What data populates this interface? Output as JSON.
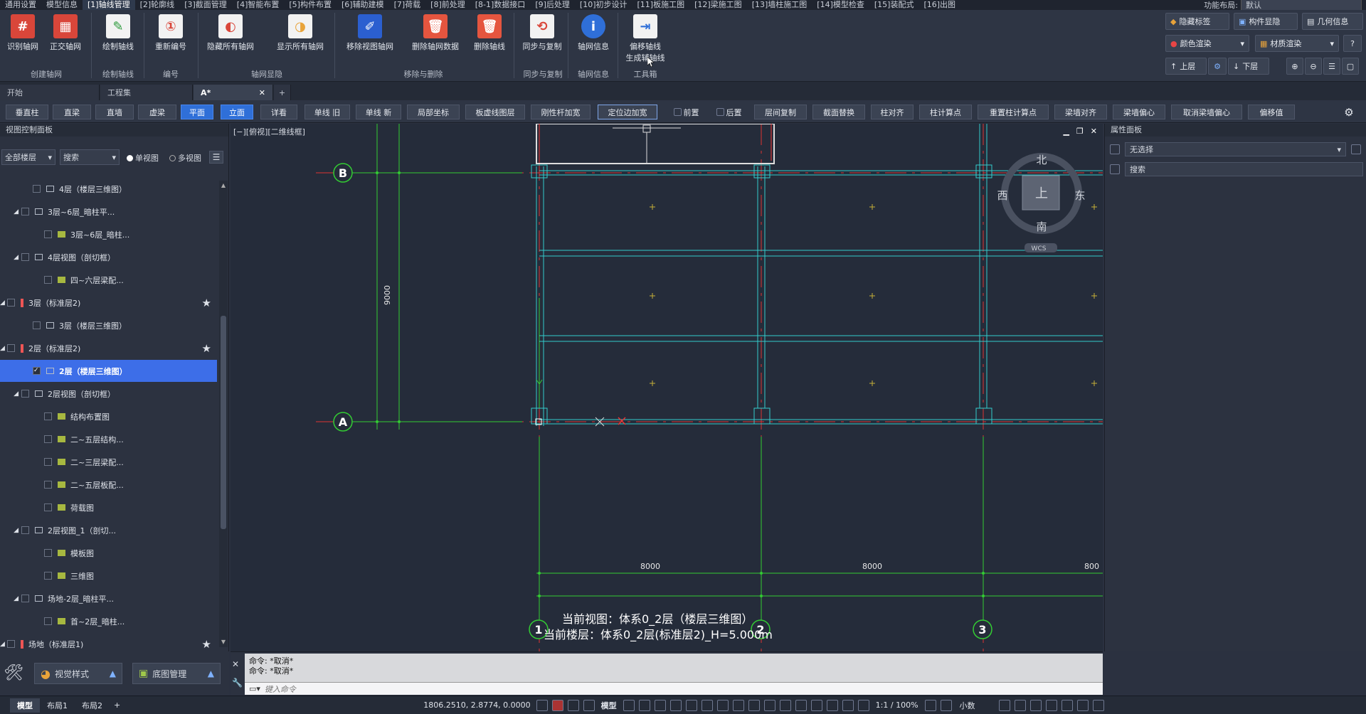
{
  "menu": {
    "items": [
      "通用设置",
      "模型信息",
      "[1]轴线管理",
      "[2]轮廓线",
      "[3]截面管理",
      "[4]智能布置",
      "[5]构件布置",
      "[6]辅助建模",
      "[7]荷载",
      "[8]前处理",
      "[8-1]数据接口",
      "[9]后处理",
      "[10]初步设计",
      "[11]板施工图",
      "[12]梁施工图",
      "[13]墙柱施工图",
      "[14]模型检查",
      "[15]装配式",
      "[16]出图"
    ],
    "layout_label": "功能布局:",
    "layout_value": "默认"
  },
  "ribbon": {
    "buttons": [
      "识别轴网",
      "正交轴网",
      "绘制轴线",
      "重新编号",
      "隐藏所有轴网",
      "显示所有轴网",
      "移除视图轴网",
      "删除轴网数据",
      "删除轴线",
      "同步与复制",
      "轴网信息",
      "偏移轴线",
      "生成辅轴线"
    ],
    "groups": [
      "创建轴网",
      "绘制轴线",
      "编号",
      "轴网显隐",
      "移除与删除",
      "同步与复制",
      "轴网信息",
      "工具箱"
    ],
    "right": {
      "hide_tag": "隐藏标签",
      "comp_show": "构件显隐",
      "geo_info": "几何信息",
      "color_render": "颜色渲染",
      "material_render": "材质渲染",
      "up_floor": "上层",
      "down_floor": "下层"
    }
  },
  "tabs": [
    {
      "label": "开始"
    },
    {
      "label": "工程集"
    },
    {
      "label": "A*"
    }
  ],
  "toolbar": [
    "垂直柱",
    "直梁",
    "直墙",
    "虚梁",
    "平面",
    "立面",
    "详看",
    "单线 旧",
    "单线 新",
    "局部坐标",
    "板虚线图层",
    "刚性杆加宽",
    "定位边加宽",
    "前置",
    "后置",
    "层间复制",
    "截面替换",
    "柱对齐",
    "柱计算点",
    "重置柱计算点",
    "梁墙对齐",
    "梁墙偏心",
    "取消梁墙偏心",
    "偏移值"
  ],
  "left": {
    "title": "视图控制面板",
    "floor_filter": "全部楼层",
    "search": "搜索",
    "single": "单视图",
    "multi": "多视图",
    "tree": [
      {
        "label": "4层（楼层三维图）",
        "level": 2
      },
      {
        "label": "3层~6层_暗柱平...",
        "level": 1
      },
      {
        "label": "3层~6层_暗柱...",
        "level": 3
      },
      {
        "label": "4层视图（剖切框）",
        "level": 1
      },
      {
        "label": "四~六层梁配...",
        "level": 3
      },
      {
        "label": "3层（标准层2)",
        "level": 0
      },
      {
        "label": "3层（楼层三维图）",
        "level": 2
      },
      {
        "label": "2层（标准层2)",
        "level": 0
      },
      {
        "label": "2层（楼层三维图）",
        "level": 2
      },
      {
        "label": "2层视图（剖切框）",
        "level": 1
      },
      {
        "label": "结构布置图",
        "level": 3
      },
      {
        "label": "二~五层结构...",
        "level": 3
      },
      {
        "label": "二~三层梁配...",
        "level": 3
      },
      {
        "label": "二~五层板配...",
        "level": 3
      },
      {
        "label": "荷载图",
        "level": 3
      },
      {
        "label": "2层视图_1（剖切...",
        "level": 1
      },
      {
        "label": "模板图",
        "level": 3
      },
      {
        "label": "三维图",
        "level": 3
      },
      {
        "label": "场地-2层_暗柱平...",
        "level": 1
      },
      {
        "label": "首~2层_暗柱...",
        "level": 3
      },
      {
        "label": "场地（标准层1)",
        "level": 0
      }
    ],
    "bottom": {
      "view_style": "视觉样式",
      "base_manage": "底图管理"
    }
  },
  "viewport": {
    "view_label": "[−][俯视][二维线框]",
    "axis_labels": {
      "B": "B",
      "A": "A",
      "n1": "1",
      "n2": "2",
      "n3": "3"
    },
    "dim_9000": "9000",
    "dim_8000a": "8000",
    "dim_8000b": "8000",
    "dim_8000c": "800",
    "info_view": "当前视图：体系0_2层（楼层三维图）",
    "info_floor": "当前楼层：体系0_2层(标准层2)_H=5.000m",
    "compass": {
      "n": "北",
      "s": "南",
      "e": "东",
      "w": "西",
      "top": "上",
      "wcs": "WCS"
    }
  },
  "right": {
    "title": "属性面板",
    "select": "无选择",
    "search": "搜索"
  },
  "cmd": {
    "lines": [
      "命令: *取消*",
      "命令: *取消*"
    ],
    "placeholder": "键入命令"
  },
  "status": {
    "tabs": [
      "模型",
      "布局1",
      "布局2"
    ],
    "coords": "1806.2510, 2.8774, 0.0000",
    "mode": "模型",
    "scale": "1:1 / 100%",
    "unit": "小数"
  }
}
